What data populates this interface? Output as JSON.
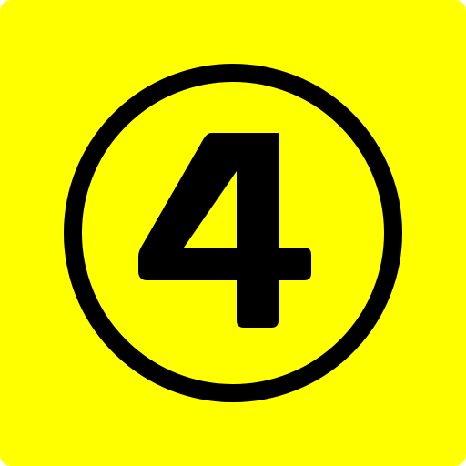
{
  "icon": {
    "name": "number-4-circle-icon",
    "digit": "4",
    "colors": {
      "background": "#ffff00",
      "foreground": "#000000"
    }
  }
}
